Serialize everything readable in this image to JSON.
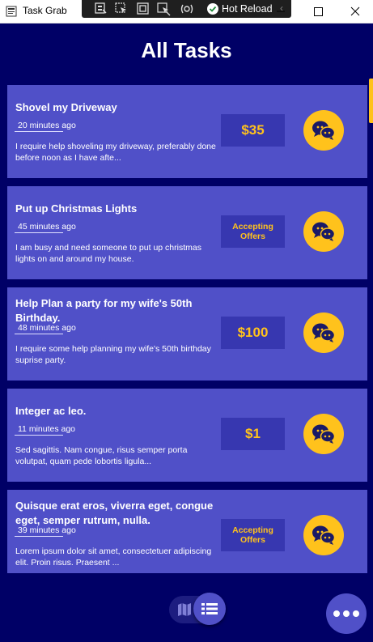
{
  "window": {
    "title": "Task Grab",
    "hot_reload_label": "Hot Reload"
  },
  "page": {
    "title": "All Tasks"
  },
  "colors": {
    "background": "#000066",
    "card": "#5050c8",
    "price_box": "#3737b0",
    "accent": "#ffc21c"
  },
  "tasks": [
    {
      "title": "Shovel my Driveway",
      "time": "20 minutes ago",
      "description": "I require help shoveling my driveway, preferably done before noon as I have afte...",
      "price": "$35"
    },
    {
      "title": "Put up Christmas Lights",
      "time": "45 minutes ago",
      "description": "I am busy and need someone to put up christmas lights on and around my house.",
      "price": "Accepting Offers"
    },
    {
      "title": "Help Plan a party for my wife's 50th Birthday.",
      "time": "48 minutes ago",
      "description": "I require some help planning my wife's 50th birthday suprise party.",
      "price": "$100"
    },
    {
      "title": "Integer ac leo.",
      "time": "11 minutes ago",
      "description": "Sed sagittis. Nam congue, risus semper porta volutpat, quam pede lobortis ligula...",
      "price": "$1"
    },
    {
      "title": "Quisque erat eros, viverra eget, congue eget, semper rutrum, nulla.",
      "time": "39 minutes ago",
      "description": "Lorem ipsum dolor sit amet, consectetuer adipiscing elit. Proin risus. Praesent ...",
      "price": "Accepting Offers"
    }
  ],
  "icons": {
    "chat": "chat-bubbles-icon",
    "map": "map-icon",
    "list": "list-icon",
    "more": "more-icon"
  }
}
